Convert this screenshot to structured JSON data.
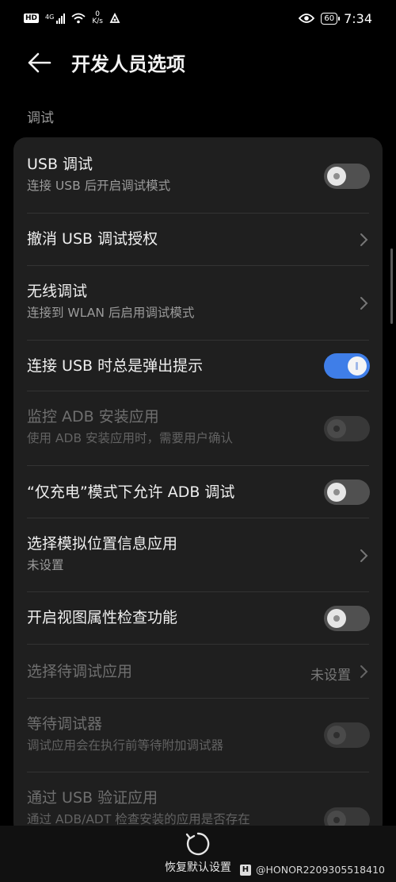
{
  "status": {
    "hd": "HD",
    "signal_label": "4G",
    "speed_value": "0",
    "speed_unit": "K/s",
    "battery": "60",
    "time": "7:34"
  },
  "header": {
    "title": "开发人员选项"
  },
  "section": {
    "label": "调试"
  },
  "rows": [
    {
      "title": "USB 调试",
      "subtitle": "连接 USB 后开启调试模式"
    },
    {
      "title": "撤消 USB 调试授权"
    },
    {
      "title": "无线调试",
      "subtitle": "连接到 WLAN 后启用调试模式"
    },
    {
      "title": "连接 USB 时总是弹出提示"
    },
    {
      "title": "监控 ADB 安装应用",
      "subtitle": "使用 ADB 安装应用时，需要用户确认"
    },
    {
      "title": "“仅充电”模式下允许 ADB 调试"
    },
    {
      "title": "选择模拟位置信息应用",
      "subtitle": "未设置"
    },
    {
      "title": "开启视图属性检查功能"
    },
    {
      "title": "选择待调试应用",
      "value": "未设置"
    },
    {
      "title": "等待调试器",
      "subtitle": "调试应用会在执行前等待附加调试器"
    },
    {
      "title": "通过 USB 验证应用",
      "subtitle": "通过 ADB/ADT 检查安装的应用是否存在"
    }
  ],
  "toggles": {
    "usb_debugging": false,
    "always_prompt_usb": true,
    "monitor_adb": false,
    "charge_only_adb": false,
    "view_attribute_inspection": false,
    "wait_for_debugger": false,
    "verify_apps_usb": false
  },
  "footer": {
    "reset_label": "恢复默认设置",
    "watermark_logo": "H",
    "watermark": "@HONOR2209305518410"
  },
  "colors": {
    "accent": "#3f7ee8",
    "card": "#1f1f1f",
    "background": "#000000"
  }
}
